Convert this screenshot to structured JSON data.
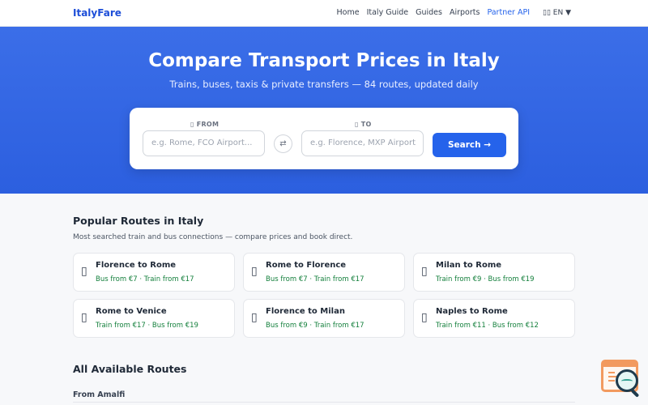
{
  "header": {
    "logo": "ItalyFare",
    "nav": [
      "Home",
      "Italy Guide",
      "Guides",
      "Airports",
      "Partner API"
    ],
    "lang_flag_icon": "flag-icon",
    "lang": "EN ▼"
  },
  "hero": {
    "title": "Compare Transport Prices in Italy",
    "subtitle": "Trains, buses, taxis & private transfers — 84 routes, updated daily"
  },
  "search": {
    "from_icon": "pin-icon",
    "from_label": "FROM",
    "from_placeholder": "e.g. Rome, FCO Airport...",
    "swap_icon": "⇄",
    "to_icon": "flag-icon",
    "to_label": "TO",
    "to_placeholder": "e.g. Florence, MXP Airport",
    "button": "Search →"
  },
  "popular": {
    "title": "Popular Routes in Italy",
    "subtitle": "Most searched train and bus connections — compare prices and book direct.",
    "routes": [
      {
        "title": "Florence to Rome",
        "price": "Bus from €7 · Train from €17",
        "icon": "route-icon"
      },
      {
        "title": "Rome to Florence",
        "price": "Bus from €7 · Train from €17",
        "icon": "route-icon"
      },
      {
        "title": "Milan to Rome",
        "price": "Train from €9 · Bus from €19",
        "icon": "route-icon"
      },
      {
        "title": "Rome to Venice",
        "price": "Train from €17 · Bus from €19",
        "icon": "route-icon"
      },
      {
        "title": "Florence to Milan",
        "price": "Bus from €9 · Train from €17",
        "icon": "route-icon"
      },
      {
        "title": "Naples to Rome",
        "price": "Train from €11 · Bus from €12",
        "icon": "route-icon"
      }
    ]
  },
  "all_routes": {
    "title": "All Available Routes",
    "first_group": "From Amalfi"
  },
  "colors": {
    "accent": "#2563eb",
    "hero": "#2c5fdf",
    "price": "#15803d"
  }
}
